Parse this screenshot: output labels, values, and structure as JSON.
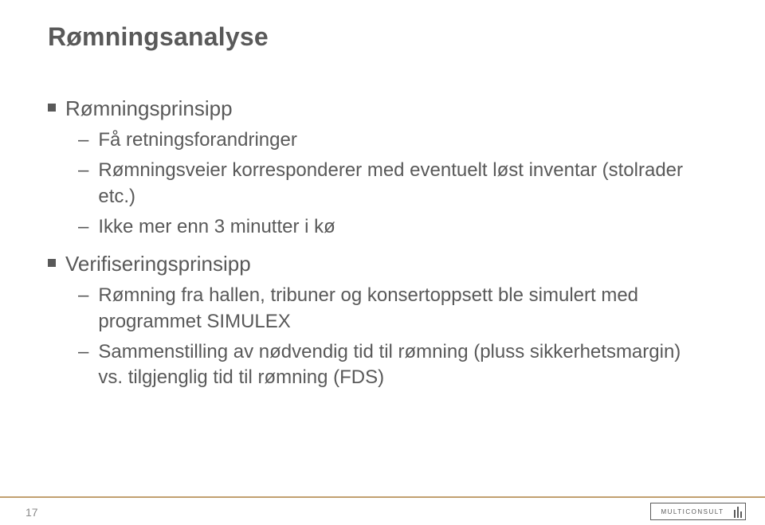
{
  "title": "Rømningsanalyse",
  "sections": [
    {
      "heading": "Rømningsprinsipp",
      "items": [
        "Få retningsforandringer",
        "Rømningsveier korresponderer med eventuelt løst inventar (stolrader etc.)",
        "Ikke mer enn 3 minutter i kø"
      ]
    },
    {
      "heading": "Verifiseringsprinsipp",
      "items": [
        "Rømning fra hallen, tribuner og konsertoppsett ble simulert med programmet SIMULEX",
        "Sammenstilling av nødvendig tid til rømning (pluss sikkerhetsmargin)  vs. tilgjenglig tid til rømning (FDS)"
      ]
    }
  ],
  "page_number": "17",
  "logo_text": "MULTICONSULT",
  "colors": {
    "text": "#595959",
    "accent": "#c2a070"
  }
}
